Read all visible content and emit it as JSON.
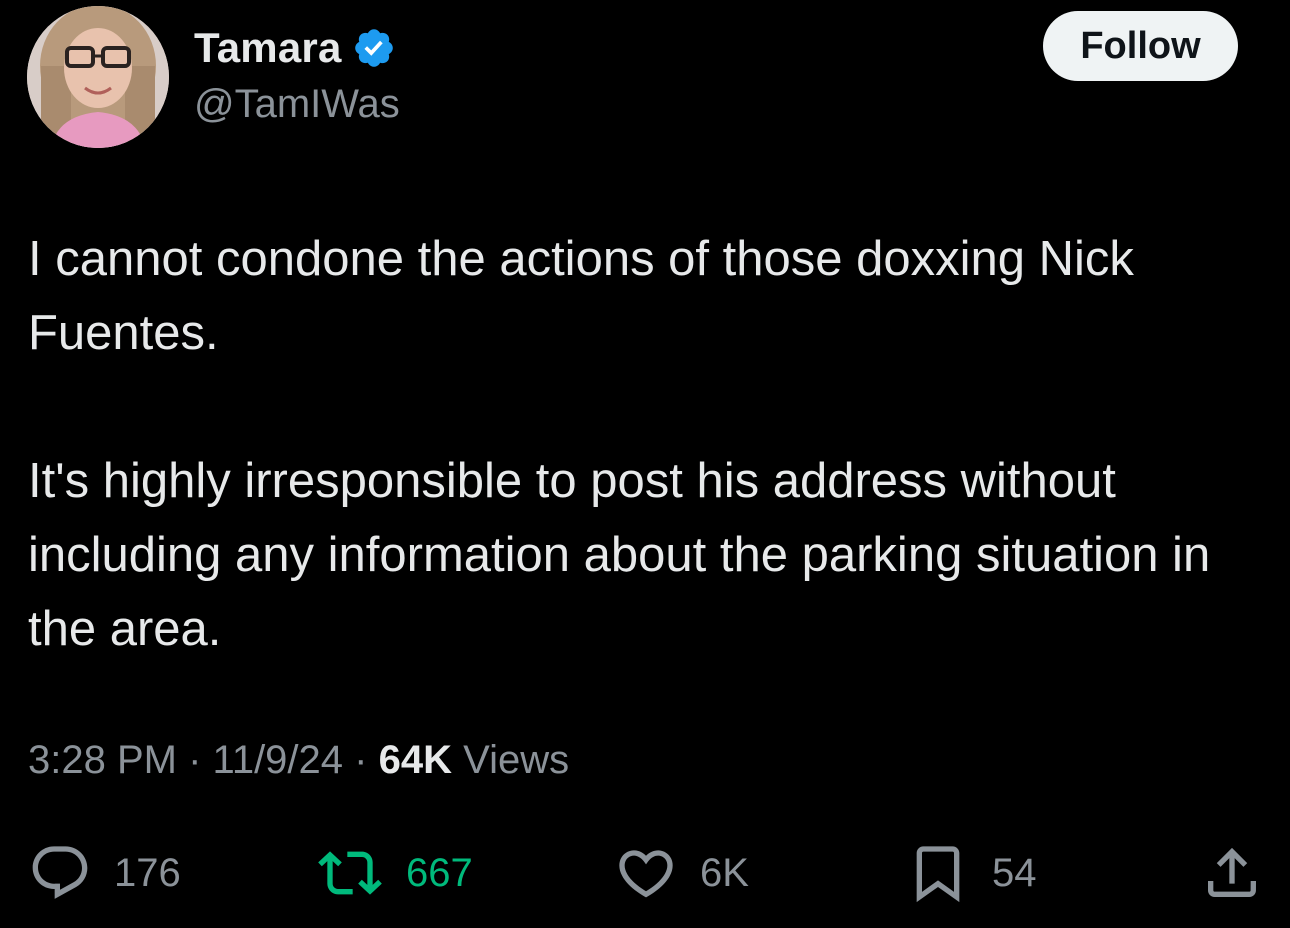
{
  "author": {
    "display_name": "Tamara",
    "handle": "@TamIWas",
    "verified_icon": "verified-badge-icon",
    "verified_color": "#1d9bf0"
  },
  "follow_button": {
    "label": "Follow"
  },
  "tweet": {
    "paragraphs": [
      "I cannot condone the actions of those doxxing Nick Fuentes.",
      "It's highly irresponsible to post his address without including any information about the parking situation in the area."
    ]
  },
  "meta": {
    "time": "3:28 PM",
    "date": "11/9/24",
    "views_count": "64K",
    "views_label": "Views",
    "separator": "·"
  },
  "actions": {
    "reply": {
      "icon": "reply-icon",
      "count": "176"
    },
    "retweet": {
      "icon": "retweet-icon",
      "count": "667",
      "color": "#00ba7c"
    },
    "like": {
      "icon": "heart-icon",
      "count": "6K"
    },
    "bookmark": {
      "icon": "bookmark-icon",
      "count": "54"
    },
    "share": {
      "icon": "share-icon"
    }
  },
  "colors": {
    "background": "#000000",
    "text_primary": "#e7e9ea",
    "text_secondary": "#8b9299",
    "accent": "#1d9bf0"
  }
}
